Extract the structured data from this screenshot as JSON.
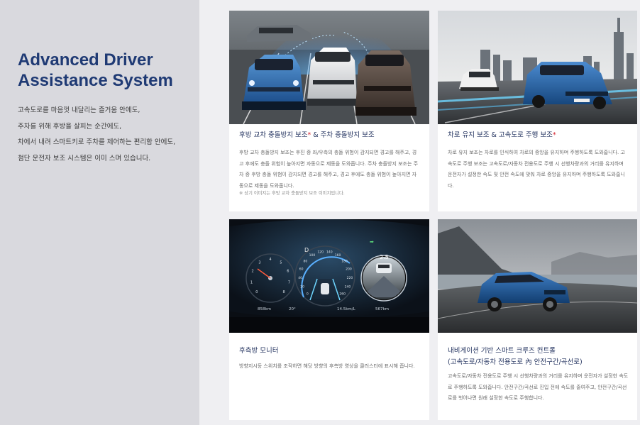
{
  "intro": {
    "title_line1": "Advanced Driver",
    "title_line2": "Assistance System",
    "desc_lines": [
      "고속도로를 마음껏 내달리는 즐거움 안에도,",
      "주차를 위해 후방을 살피는 순간에도,",
      "차에서 내려 스마트키로 주차를 제어하는 편리함 안에도,",
      "첨단 운전자 보조 시스템은 이미 스며 있습니다."
    ]
  },
  "cards": [
    {
      "title": "후방 교차 충돌방지 보조",
      "star": "*",
      "title_suffix": " & 주차 충돌방지 보조",
      "body": "후방 교차 충돌방지 보조는 후진 중 좌/우측의 충돌 위험이 감지되면 경고를 해주고, 경고 후에도 충돌 위험이 높아지면 자동으로 제동을 도와줍니다. 주차 충돌방지 보조는 주차 중 후방 충돌 위험이 감지되면 경고를 해주고, 경고 후에도 충돌 위험이 높아지면 자동으로 제동을 도와줍니다.",
      "note": "※ 상기 이미지는 후방 교차 충돌방지 보조 이미지입니다."
    },
    {
      "title": "차로 유지 보조 & 고속도로 주행 보조",
      "star": "*",
      "body": "차로 유지 보조는 차로를 인식하여 차로의 중앙을 유지하며 주행하도록 도와줍니다. 고속도로 주행 보조는 고속도로/자동차 전용도로 주행 시 선행차량과의 거리를 유지하며 운전자가 설정한 속도 및 안전 속도에 맞춰 차로 중앙을 유지하며 주행하도록 도와줍니다."
    },
    {
      "title": "후측방 모니터",
      "body": "방향지시등 스위치를 조작하면 해당 방향의 후측방 영상을 클러스터에 표시해 줍니다.",
      "cluster": {
        "gear": "D",
        "left_gauge_ticks": [
          "0",
          "1",
          "2",
          "3",
          "4",
          "5",
          "6",
          "7",
          "8"
        ],
        "speed_ticks": [
          "0",
          "20",
          "40",
          "60",
          "80",
          "100",
          "120",
          "140",
          "160",
          "180",
          "200",
          "220",
          "240",
          "260"
        ],
        "range": "858km",
        "temp": "20°",
        "trip": "14.5km/L",
        "odo": "567km",
        "camera_value": "2.5"
      }
    },
    {
      "title_line1": "내비게이션 기반 스마트 크루즈 컨트롤",
      "title_line2": "(고속도로/자동차 전용도로 內 안전구간/곡선로)",
      "body": "고속도로/자동차 전용도로 주행 시 선행차량과의 거리를 유지하며 운전자가 설정한 속도로 주행하도록 도와줍니다. 안전구간/곡선로 진입 전에 속도를 줄여주고, 안전구간/곡선로를 벗어나면 원래 설정한 속도로 주행합니다."
    }
  ],
  "colors": {
    "title_navy": "#1f3a74",
    "card_title": "#1f2f5c",
    "star_red": "#d4202b",
    "car_blue": "#2f6fb4"
  }
}
